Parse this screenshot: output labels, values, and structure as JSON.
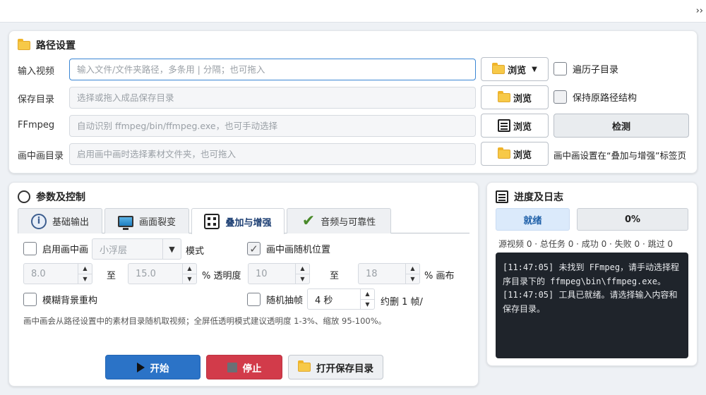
{
  "topbar": {
    "expand_label": "››"
  },
  "paths": {
    "title": "路径设置",
    "input_video": {
      "label": "输入视频",
      "value": "",
      "placeholder": "输入文件/文件夹路径，多条用 | 分隔；也可拖入",
      "browse_label": "浏览",
      "recursive_label": "遍历子目录",
      "recursive_checked": false
    },
    "save_dir": {
      "label": "保存目录",
      "value": "",
      "placeholder": "选择或拖入成品保存目录",
      "browse_label": "浏览",
      "keep_structure_label": "保持原路径结构",
      "keep_structure_checked": false
    },
    "ffmpeg": {
      "label": "FFmpeg",
      "value": "",
      "placeholder": "自动识别 ffmpeg/bin/ffmpeg.exe，也可手动选择",
      "browse_label": "浏览",
      "detect_label": "检测"
    },
    "pip_dir": {
      "label": "画中画目录",
      "value": "",
      "placeholder": "启用画中画时选择素材文件夹，也可拖入",
      "browse_label": "浏览",
      "note": "画中画设置在“叠加与增强”标签页"
    }
  },
  "params": {
    "title": "参数及控制",
    "tabs": [
      {
        "label": "基础输出",
        "icon": "info-icon",
        "selected": false
      },
      {
        "label": "画面裂变",
        "icon": "monitor-icon",
        "selected": false
      },
      {
        "label": "叠加与增强",
        "icon": "grid-icon",
        "selected": true
      },
      {
        "label": "音频与可靠性",
        "icon": "check-icon",
        "selected": false
      }
    ],
    "overlay": {
      "enable_pip_label": "启用画中画",
      "enable_pip_checked": false,
      "mode_value": "小浮层",
      "mode_label": "模式",
      "random_pos_label": "画中画随机位置",
      "random_pos_checked": true,
      "opacity_min": "8.0",
      "opacity_to_label": "至",
      "opacity_max": "15.0",
      "opacity_unit_label": "% 透明度",
      "canvas_min": "10",
      "canvas_to_label": "至",
      "canvas_max": "18",
      "canvas_unit_label": "% 画布",
      "blur_bg_label": "模糊背景重构",
      "blur_bg_checked": false,
      "random_frame_label": "随机抽帧",
      "random_frame_checked": false,
      "frame_interval": "4 秒",
      "frame_drop_label": "约删 1 帧/",
      "hint": "画中画会从路径设置中的素材目录随机取视频；全屏低透明模式建议透明度 1-3%、缩放 95-100%。"
    },
    "actions": {
      "start_label": "开始",
      "stop_label": "停止",
      "open_dir_label": "打开保存目录"
    }
  },
  "progress": {
    "title": "进度及日志",
    "status": "就绪",
    "percent_text": "0%",
    "percent_value": 0,
    "stats": "源视频 0 · 总任务 0 · 成功 0 · 失败 0 · 跳过 0",
    "log": [
      "[11:47:05] 未找到 FFmpeg，请手动选择程序目录下的 ffmpeg\\bin\\ffmpeg.exe。",
      "[11:47:05] 工具已就绪。请选择输入内容和保存目录。"
    ]
  },
  "colors": {
    "accent": "#2b73c7",
    "stop": "#d23b4a",
    "log_bg": "#1f242b"
  }
}
